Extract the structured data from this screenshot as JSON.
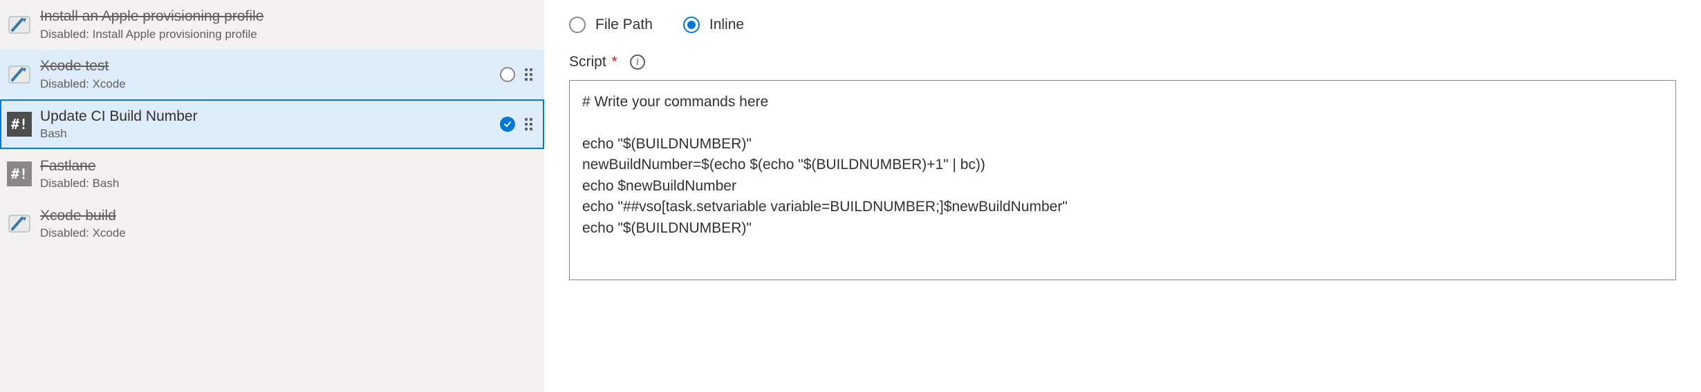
{
  "tasks": [
    {
      "title": "Install an Apple provisioning profile",
      "subtitle": "Disabled: Install Apple provisioning profile",
      "iconKind": "hammer",
      "disabled": true,
      "state": "normal"
    },
    {
      "title": "Xcode test",
      "subtitle": "Disabled: Xcode",
      "iconKind": "hammer",
      "disabled": true,
      "state": "hover"
    },
    {
      "title": "Update CI Build Number",
      "subtitle": "Bash",
      "iconKind": "bash",
      "disabled": false,
      "state": "selected"
    },
    {
      "title": "Fastlane",
      "subtitle": "Disabled: Bash",
      "iconKind": "bash-dim",
      "disabled": true,
      "state": "normal"
    },
    {
      "title": "Xcode build",
      "subtitle": "Disabled: Xcode",
      "iconKind": "hammer",
      "disabled": true,
      "state": "normal"
    }
  ],
  "detail": {
    "typeOptions": {
      "filePath": "File Path",
      "inline": "Inline",
      "selected": "inline"
    },
    "scriptLabel": "Script",
    "scriptRequired": true,
    "scriptValue": "# Write your commands here\n\necho \"$(BUILDNUMBER)\"\nnewBuildNumber=$(echo $(echo \"$(BUILDNUMBER)+1\" | bc))\necho $newBuildNumber\necho \"##vso[task.setvariable variable=BUILDNUMBER;]$newBuildNumber\"\necho \"$(BUILDNUMBER)\""
  }
}
